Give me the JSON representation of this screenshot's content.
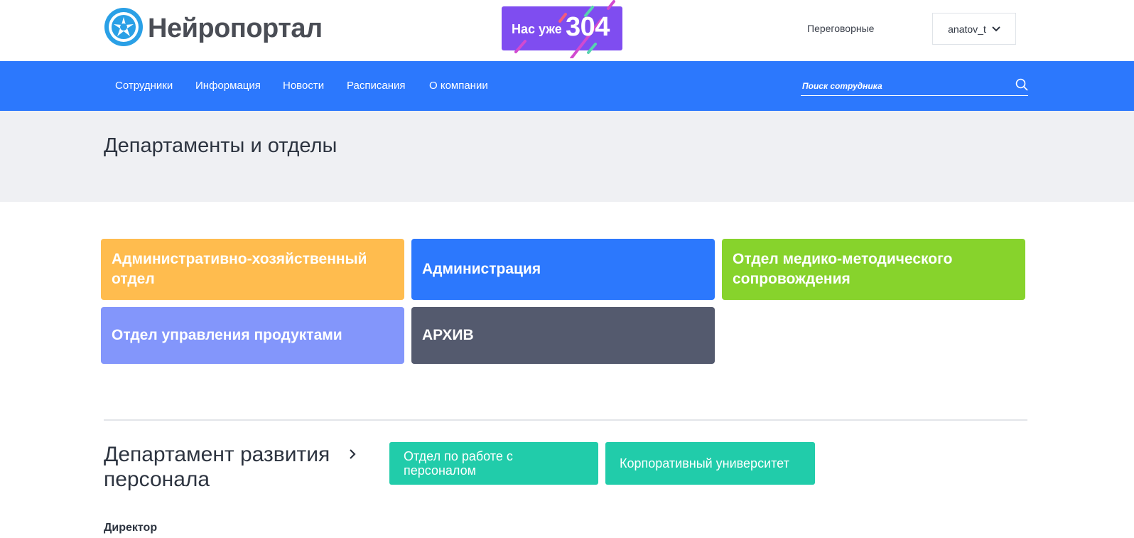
{
  "header": {
    "logo_text": "Нейропортал",
    "promo": {
      "label": "Нас уже",
      "count": "304"
    },
    "meetings_link": "Переговорные",
    "user": {
      "name": "anatov_t"
    }
  },
  "nav": {
    "items": [
      {
        "label": "Сотрудники"
      },
      {
        "label": "Информация"
      },
      {
        "label": "Новости"
      },
      {
        "label": "Расписания"
      },
      {
        "label": "О компании"
      }
    ],
    "search": {
      "placeholder": "Поиск сотрудника",
      "value": ""
    }
  },
  "page": {
    "title": "Департаменты и отделы"
  },
  "departments": [
    {
      "label": "Административно-хозяйственный отдел",
      "color": "#ffbc4e"
    },
    {
      "label": "Администрация",
      "color": "#2c78fd"
    },
    {
      "label": "Отдел медико-методического сопровождения",
      "color": "#87d32c"
    },
    {
      "label": "Отдел управления продуктами",
      "color": "#8396fb"
    },
    {
      "label": "АРХИВ",
      "color": "#545a6e"
    }
  ],
  "department_section": {
    "title": "Департамент развития персонала",
    "subdepartments": [
      {
        "label": "Отдел по работе с персоналом"
      },
      {
        "label": "Корпоративный университет"
      }
    ],
    "director_label": "Директор"
  },
  "colors": {
    "nav_blue": "#2c78fd",
    "promo_purple": "#7f4df0",
    "teal": "#21ccaa",
    "hero_bg": "#eff0f3"
  }
}
